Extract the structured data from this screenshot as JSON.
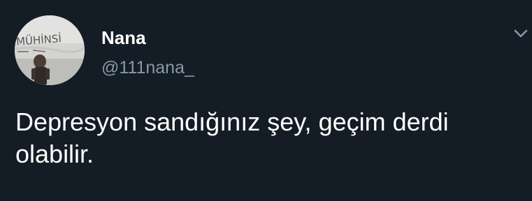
{
  "tweet": {
    "display_name": "Nana",
    "handle": "@111nana_",
    "text": "Depresyon sandığınız şey, geçim derdi olabilir."
  },
  "avatar": {
    "graffiti_text": "MÜHİNSİ"
  },
  "icons": {
    "menu": "chevron-down-icon"
  },
  "colors": {
    "background": "#141d26",
    "name": "#ffffff",
    "handle": "#8899a6",
    "text": "#ffffff"
  }
}
